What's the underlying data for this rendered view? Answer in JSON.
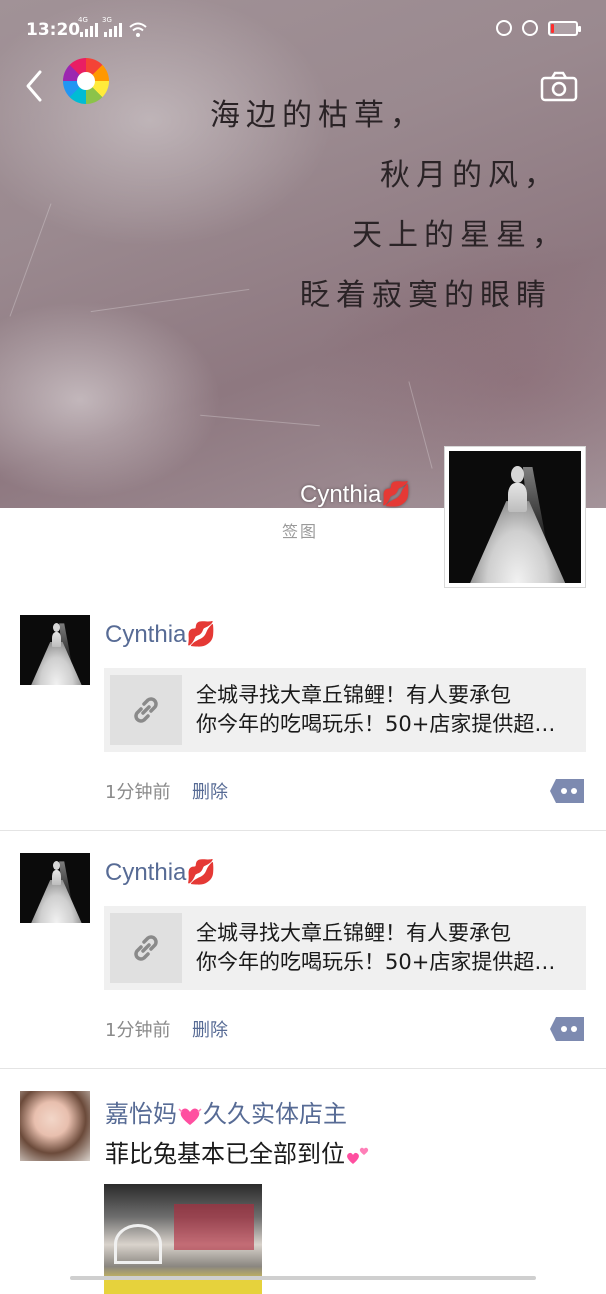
{
  "status_bar": {
    "time": "13:20",
    "signal_1_label": "4G",
    "signal_2_label": "3G",
    "battery_percent": 12,
    "battery_color": "#ff2d2d"
  },
  "header": {
    "back_icon": "chevron-left-icon",
    "app_icon": "aperture-logo-icon",
    "camera_icon": "camera-icon"
  },
  "cover": {
    "poem_lines": [
      "海边的枯草，",
      "秋月的风，",
      "天上的星星，",
      "眨着寂寞的眼睛"
    ],
    "display_name": "Cynthia💋",
    "signature": "签图"
  },
  "colors": {
    "name_link": "#576b95",
    "text": "#1a1a1a",
    "meta": "#8a8a8a",
    "card_bg": "#f0f0f0",
    "comment_button": "#7d8ab0"
  },
  "posts": [
    {
      "author": "Cynthia💋",
      "link_text_line1": "全城寻找大章丘锦鲤！有人要承包",
      "link_text_line2": "你今年的吃喝玩乐！50+店家提供超…",
      "link_icon": "link-icon",
      "time": "1分钟前",
      "delete_label": "删除"
    },
    {
      "author": "Cynthia💋",
      "link_text_line1": "全城寻找大章丘锦鲤！有人要承包",
      "link_text_line2": "你今年的吃喝玩乐！50+店家提供超…",
      "link_icon": "link-icon",
      "time": "1分钟前",
      "delete_label": "删除"
    },
    {
      "author_part1": "嘉怡妈",
      "author_part2": "久久实体店主",
      "text": "菲比兔基本已全部到位"
    }
  ]
}
